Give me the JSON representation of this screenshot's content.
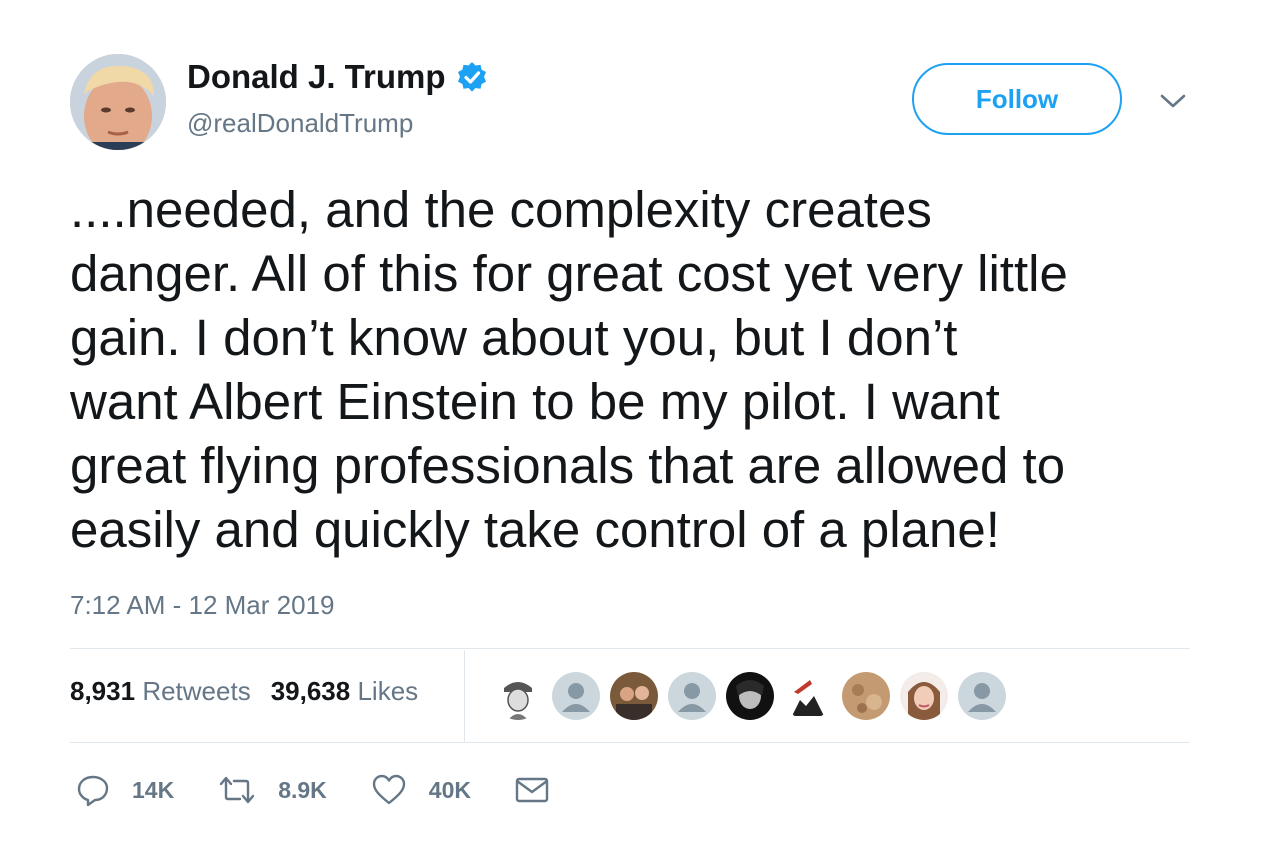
{
  "author": {
    "display_name": "Donald J. Trump",
    "handle": "@realDonaldTrump",
    "verified": true
  },
  "header": {
    "follow_label": "Follow"
  },
  "tweet": {
    "lines": [
      "....needed, and the complexity creates",
      "danger. All of this for great cost yet very little",
      "gain. I don’t know about you, but I don’t",
      "want Albert Einstein to be my pilot. I want",
      "great flying professionals that are allowed to",
      "easily and quickly take control of a plane!"
    ],
    "timestamp": "7:12 AM - 12 Mar 2019"
  },
  "stats": {
    "retweets_count": "8,931",
    "retweets_label": "Retweets",
    "likes_count": "39,638",
    "likes_label": "Likes"
  },
  "actions": {
    "reply_count": "14K",
    "retweet_count": "8.9K",
    "like_count": "40K"
  },
  "colors": {
    "accent": "#1da1f2",
    "secondary_text": "#657786",
    "primary_text": "#14171a",
    "divider": "#e1e8ed"
  }
}
